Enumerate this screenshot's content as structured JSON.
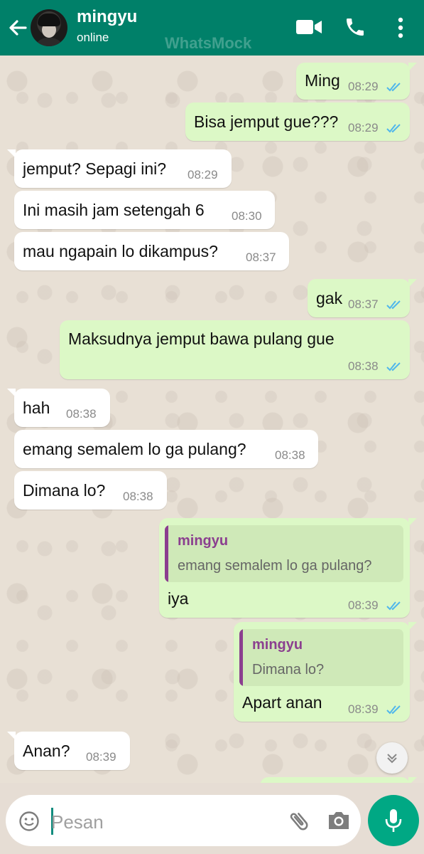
{
  "header": {
    "contact_name": "mingyu",
    "status": "online",
    "watermark": "WhatsMock"
  },
  "messages": [
    {
      "dir": "out",
      "text": "Ming",
      "time": "08:29"
    },
    {
      "dir": "out",
      "text": "Bisa jemput gue???",
      "time": "08:29"
    },
    {
      "dir": "in",
      "text": "jemput? Sepagi ini?",
      "time": "08:29"
    },
    {
      "dir": "in",
      "text": "Ini masih jam setengah 6",
      "time": "08:30"
    },
    {
      "dir": "in",
      "text": "mau ngapain lo dikampus?",
      "time": "08:37"
    },
    {
      "dir": "out",
      "text": "gak",
      "time": "08:37"
    },
    {
      "dir": "out",
      "text": "Maksudnya jemput bawa pulang gue",
      "time": "08:38"
    },
    {
      "dir": "in",
      "text": "hah",
      "time": "08:38"
    },
    {
      "dir": "in",
      "text": "emang semalem lo ga pulang?",
      "time": "08:38"
    },
    {
      "dir": "in",
      "text": "Dimana lo?",
      "time": "08:38"
    },
    {
      "dir": "out",
      "text": "iya",
      "time": "08:39",
      "quote": {
        "name": "mingyu",
        "text": "emang semalem lo ga pulang?"
      }
    },
    {
      "dir": "out",
      "text": "Apart anan",
      "time": "08:39",
      "quote": {
        "name": "mingyu",
        "text": "Dimana lo?"
      }
    },
    {
      "dir": "in",
      "text": "Anan?",
      "time": "08:39"
    }
  ],
  "composer": {
    "placeholder": "Pesan"
  },
  "colors": {
    "header": "#008069",
    "outgoing_bubble": "#dcf8c6",
    "incoming_bubble": "#ffffff",
    "read_ticks": "#4fb6ec",
    "quote_accent": "#8b3f8f",
    "mic_button": "#00a884"
  },
  "icons": [
    "back-arrow-icon",
    "video-call-icon",
    "phone-icon",
    "more-vert-icon",
    "read-ticks-icon",
    "scroll-down-icon",
    "emoji-icon",
    "attach-icon",
    "camera-icon",
    "mic-icon"
  ]
}
